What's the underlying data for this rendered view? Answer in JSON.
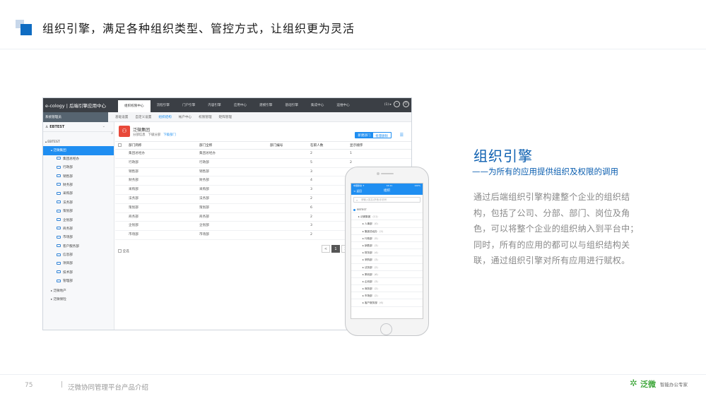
{
  "header": {
    "title": "组织引擎，满足各种组织类型、管控方式，让组织更为灵活"
  },
  "desktop": {
    "brand": "e-cology | 后端引擎应用中心",
    "tabs": [
      "组织权限中心",
      "流程引擎",
      "门户引擎",
      "内容引擎",
      "应用中心",
      "建模引擎",
      "基础引擎",
      "集成中心",
      "运维中心"
    ],
    "user": "(1) ▸",
    "system_menu": "系统管理员",
    "subtabs": [
      "基础设置",
      "自定义设置",
      "组织结构",
      "帐户中心",
      "权限管理",
      "矩阵管理"
    ],
    "tree_header": "EBTEST",
    "tree": [
      {
        "label": "EBTEST",
        "level": 0,
        "folder": false,
        "selected": false
      },
      {
        "label": "泛微集团",
        "level": 1,
        "folder": false,
        "selected": true
      },
      {
        "label": "集团总经办",
        "level": 2,
        "folder": true,
        "selected": false
      },
      {
        "label": "行政部",
        "level": 2,
        "folder": true,
        "selected": false
      },
      {
        "label": "销售部",
        "level": 2,
        "folder": true,
        "selected": false
      },
      {
        "label": "财务部",
        "level": 2,
        "folder": true,
        "selected": false
      },
      {
        "label": "采购部",
        "level": 2,
        "folder": true,
        "selected": false
      },
      {
        "label": "法务部",
        "level": 2,
        "folder": true,
        "selected": false
      },
      {
        "label": "策划部",
        "level": 2,
        "folder": true,
        "selected": false
      },
      {
        "label": "企划部",
        "level": 2,
        "folder": true,
        "selected": false
      },
      {
        "label": "商务部",
        "level": 2,
        "folder": true,
        "selected": false
      },
      {
        "label": "市场部",
        "level": 2,
        "folder": true,
        "selected": false
      },
      {
        "label": "客户服务部",
        "level": 2,
        "folder": true,
        "selected": false
      },
      {
        "label": "信息部",
        "level": 2,
        "folder": true,
        "selected": false
      },
      {
        "label": "项目部",
        "level": 2,
        "folder": true,
        "selected": false
      },
      {
        "label": "技术部",
        "level": 2,
        "folder": true,
        "selected": false
      },
      {
        "label": "管理部",
        "level": 2,
        "folder": true,
        "selected": false
      },
      {
        "label": "泛微地产",
        "level": 1,
        "folder": false,
        "selected": false
      },
      {
        "label": "泛微保险",
        "level": 1,
        "folder": false,
        "selected": false
      }
    ],
    "org": {
      "name": "泛微集团",
      "subtabs": [
        "分部信息",
        "下级分部",
        "下级部门"
      ],
      "btn_new": "新建部门",
      "btn_del": "批量删除"
    },
    "table": {
      "headers": [
        "部门简称",
        "部门全称",
        "部门编号",
        "在职人数",
        "显示顺序"
      ],
      "rows": [
        [
          "集团总经办",
          "集团总经办",
          "",
          "2",
          "1"
        ],
        [
          "行政部",
          "行政部",
          "",
          "5",
          "2"
        ],
        [
          "销售部",
          "销售部",
          "",
          "3",
          ""
        ],
        [
          "财务部",
          "财务部",
          "",
          "4",
          ""
        ],
        [
          "采购部",
          "采购部",
          "",
          "3",
          ""
        ],
        [
          "法务部",
          "法务部",
          "",
          "2",
          ""
        ],
        [
          "策划部",
          "策划部",
          "",
          "6",
          ""
        ],
        [
          "商务部",
          "商务部",
          "",
          "2",
          ""
        ],
        [
          "企划部",
          "企划部",
          "",
          "3",
          ""
        ],
        [
          "市场部",
          "市场部",
          "",
          "2",
          ""
        ]
      ]
    },
    "select_all": "全选",
    "pager": [
      "<",
      "1",
      "2",
      ">"
    ]
  },
  "phone": {
    "status_left": "中国移动 ✈",
    "status_center": "16:21",
    "status_right": "100%",
    "nav_back": "< 返回",
    "nav_title": "组织",
    "search_placeholder": "请输入姓名/拼音/手机号",
    "tree": [
      {
        "label": "EBTEST",
        "count": "",
        "root": true
      },
      {
        "label": "泛微集团",
        "count": "(11)",
        "root": false
      },
      {
        "label": "人事部",
        "count": "(0)",
        "root": false
      },
      {
        "label": "集团总经办",
        "count": "(2)",
        "root": false
      },
      {
        "label": "行政部",
        "count": "(5)",
        "root": false
      },
      {
        "label": "销售部",
        "count": "(3)",
        "root": false
      },
      {
        "label": "财务部",
        "count": "(4)",
        "root": false
      },
      {
        "label": "采购部",
        "count": "(3)",
        "root": false
      },
      {
        "label": "法务部",
        "count": "(2)",
        "root": false
      },
      {
        "label": "策划部",
        "count": "(6)",
        "root": false
      },
      {
        "label": "企划部",
        "count": "(3)",
        "root": false
      },
      {
        "label": "商务部",
        "count": "(2)",
        "root": false
      },
      {
        "label": "市场部",
        "count": "(2)",
        "root": false
      },
      {
        "label": "客户服务部",
        "count": "(6)",
        "root": false
      }
    ]
  },
  "feature": {
    "title": "组织引擎",
    "subtitle": "——为所有的应用提供组织及权限的调用",
    "body": "通过后端组织引擎构建整个企业的组织结构，包括了公司、分部、部门、岗位及角色，可以将整个企业的组织纳入到平台中；同时，所有的应用的都可以与组织结构关联，通过组织引擎对所有应用进行赋权。"
  },
  "footer": {
    "page_number": "75",
    "separator": "|",
    "doc_title": "泛微协同管理平台产品介绍",
    "logo_name": "泛微",
    "slogan": "智能办公专家"
  },
  "colors": {
    "accent": "#0c5fb0",
    "selected": "#1f8ef1",
    "topbar": "#3b3f45",
    "logo_green": "#3aa536"
  }
}
